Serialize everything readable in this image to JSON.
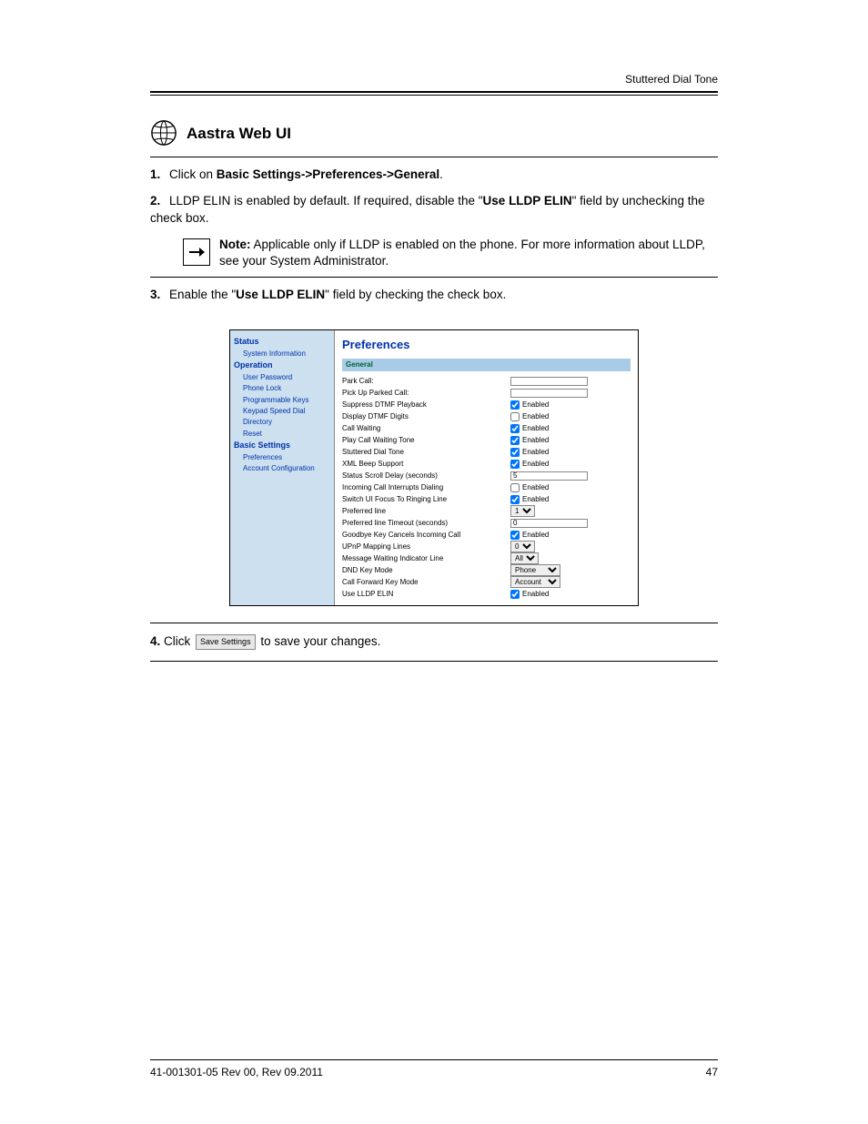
{
  "header": {
    "right": "Stuttered Dial Tone"
  },
  "section_title": "Aastra Web UI",
  "step1": {
    "num": "1.",
    "pre": "Click on ",
    "bold1": "Basic Settings->Preferences->General",
    "post": "."
  },
  "note": {
    "label": "Note:",
    "text": " LLDP is enabled on the phone. For more information about LLDP, see your System Administrator."
  },
  "step2": {
    "num": "2.",
    "pre": "LLDP ELIN is enabled by default. If required, disable the ",
    "q": "Use LLDP ELIN",
    "mid": " field by unchecking the check box.",
    "note_intro": " Applicable only if"
  },
  "step3": {
    "num": "3.",
    "pre": "Enable the \"",
    "bold": "Use LLDP ELIN",
    "post": "\" field by checking the check box."
  },
  "screenshot": {
    "sidebar": {
      "status": "Status",
      "sys": "System Information",
      "operation": "Operation",
      "user_pwd": "User Password",
      "phone_lock": "Phone Lock",
      "prog_keys": "Programmable Keys",
      "speed_dial": "Keypad Speed Dial",
      "directory": "Directory",
      "reset": "Reset",
      "basic": "Basic Settings",
      "prefs": "Preferences",
      "acct": "Account Configuration"
    },
    "title": "Preferences",
    "section": "General",
    "rows": {
      "park": "Park Call:",
      "pickup": "Pick Up Parked Call:",
      "dtmf": "Suppress DTMF Playback",
      "dtmf_d": "Display DTMF Digits",
      "cw": "Call Waiting",
      "pcwt": "Play Call Waiting Tone",
      "sdt": "Stuttered Dial Tone",
      "xml": "XML Beep Support",
      "ssd": "Status Scroll Delay (seconds)",
      "icid": "Incoming Call Interrupts Dialing",
      "suf": "Switch UI Focus To Ringing Line",
      "pl": "Preferred line",
      "plt": "Preferred line Timeout (seconds)",
      "gk": "Goodbye Key Cancels Incoming Call",
      "upnp": "UPnP Mapping Lines",
      "mwi": "Message Waiting Indicator Line",
      "dnd": "DND Key Mode",
      "cfkm": "Call Forward Key Mode",
      "lldp": "Use LLDP ELIN"
    },
    "enabled": "Enabled",
    "values": {
      "ssd": "5",
      "pl": "1",
      "plt": "0",
      "upnp": "0",
      "mwi": "All",
      "dnd": "Phone",
      "cfkm": "Account"
    }
  },
  "step4": {
    "num": "4.",
    "pre": "Click ",
    "btn": "Save Settings",
    "post": " to save your changes."
  },
  "footer": {
    "left": "41-001301-05 Rev 00, Rev 09.2011",
    "right": "47"
  }
}
